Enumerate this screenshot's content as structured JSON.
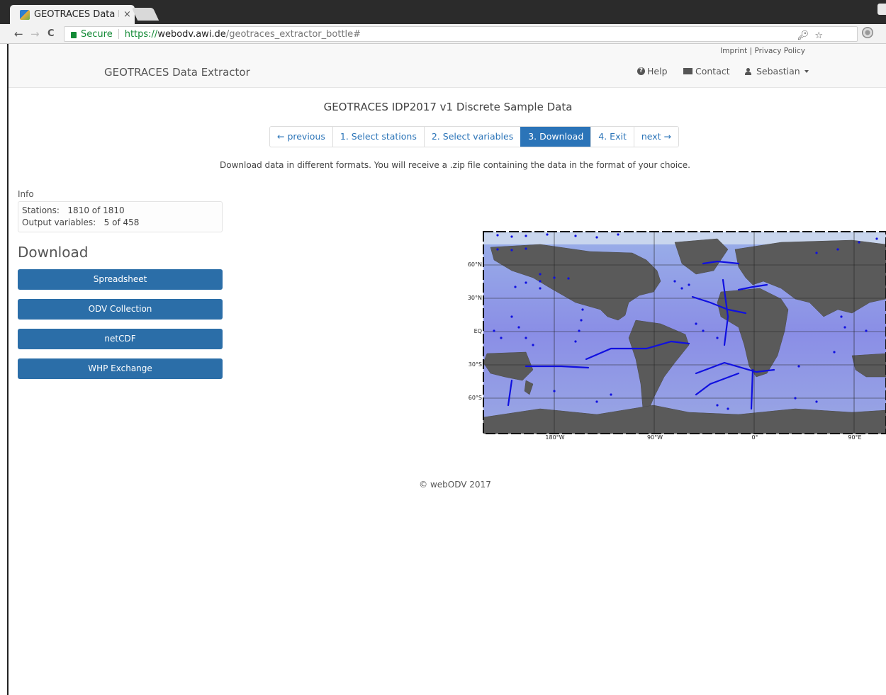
{
  "browser": {
    "tab_title": "GEOTRACES Data E",
    "tab_close": "×",
    "secure_label": "Secure",
    "url_scheme": "https://",
    "url_host": "webodv.awi.de",
    "url_path": "/geotraces_extractor_bottle#",
    "back": "←",
    "forward": "→",
    "reload": "C",
    "icons": [
      "key-icon",
      "star-icon",
      "extension-icon"
    ]
  },
  "header": {
    "brand": "GEOTRACES Data Extractor",
    "imprint": "Imprint",
    "divider": "|",
    "privacy": "Privacy Policy",
    "help": "Help",
    "contact": "Contact",
    "user": "Sebastian"
  },
  "main": {
    "title": "GEOTRACES IDP2017 v1 Discrete Sample Data",
    "pager": [
      "← previous",
      "1. Select stations",
      "2. Select variables",
      "3. Download",
      "4. Exit",
      "next →"
    ],
    "active_step": "3. Download",
    "description": "Download data in different formats. You will receive a .zip file containing the data in the format of your choice."
  },
  "info": {
    "label": "Info",
    "stations_label": "Stations:",
    "stations_value": "1810 of 1810",
    "variables_label": "Output variables:",
    "variables_value": "5 of 458"
  },
  "download": {
    "heading": "Download",
    "buttons": [
      "Spreadsheet",
      "ODV Collection",
      "netCDF",
      "WHP Exchange"
    ]
  },
  "map": {
    "lat_labels": [
      "60°N",
      "30°N",
      "EQ",
      "30°S",
      "60°S"
    ],
    "lon_labels": [
      "180°W",
      "90°W",
      "0°",
      "90°E"
    ],
    "colors": {
      "ocean": "#8a8ee6",
      "land": "#5a5a5a",
      "station": "#1010e0",
      "ice": "#d8c8c0"
    }
  },
  "footer": "© webODV 2017"
}
